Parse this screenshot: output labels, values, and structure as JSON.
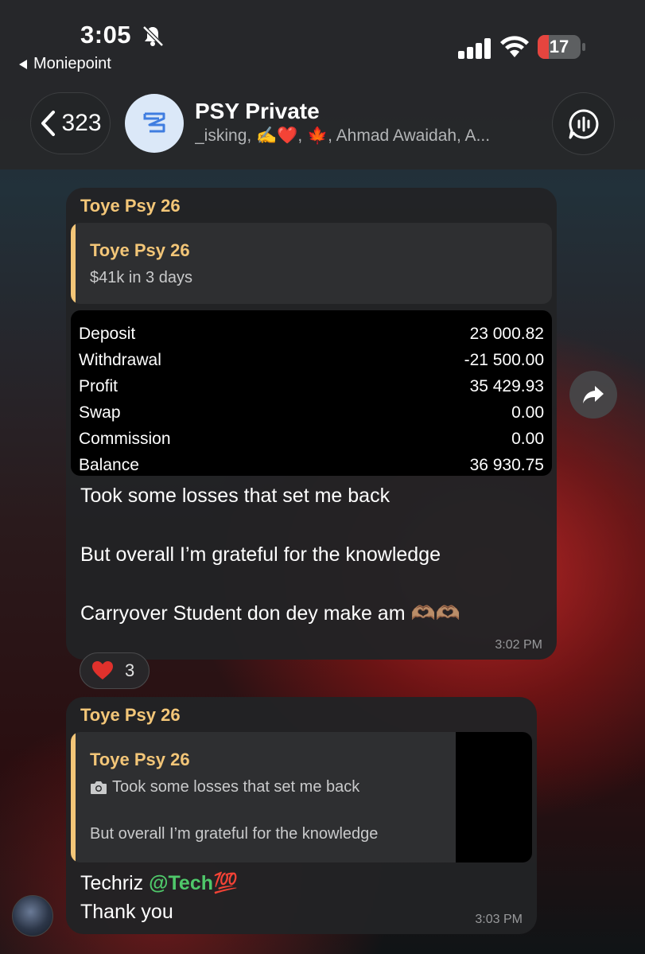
{
  "status_bar": {
    "time": "3:05",
    "back_app": "Moniepoint",
    "battery_level": "17"
  },
  "header": {
    "back_count": "323",
    "title": "PSY Private",
    "subtitle": "_isking, ✍️❤️, 🍁, Ahmad Awaidah, A..."
  },
  "messages": [
    {
      "sender": "Toye Psy 26",
      "reply": {
        "name": "Toye Psy 26",
        "text": "$41k in 3 days"
      },
      "photo_rows": [
        {
          "label": "Deposit",
          "value": "23 000.82"
        },
        {
          "label": "Withdrawal",
          "value": "-21 500.00"
        },
        {
          "label": "Profit",
          "value": "35 429.93"
        },
        {
          "label": "Swap",
          "value": "0.00"
        },
        {
          "label": "Commission",
          "value": "0.00"
        },
        {
          "label": "Balance",
          "value": "36 930.75"
        }
      ],
      "lines": [
        "Took some losses that set me back",
        "But overall I’m grateful for the knowledge",
        "Carryover Student don dey make am 🫶🏽🫶🏽"
      ],
      "time": "3:02 PM",
      "reaction": {
        "emoji": "❤️",
        "count": "3"
      }
    },
    {
      "sender": "Toye Psy 26",
      "reply": {
        "name": "Toye Psy 26",
        "line1": "Took some losses that set me back",
        "line2": "But overall I’m grateful for the knowledge"
      },
      "text_prefix": "Techriz ",
      "mention": "@Tech",
      "text_suffix": "💯",
      "text_line2": "Thank you",
      "time": "3:03 PM"
    }
  ],
  "colors": {
    "sender_name": "#f3c678",
    "mention": "#4fc86a",
    "bubble": "#222325",
    "header": "#26282a"
  },
  "icons": [
    "bell-slash-icon",
    "signal-icon",
    "wifi-icon",
    "chevron-left-icon",
    "group-avatar-icon",
    "voice-chat-icon",
    "forward-icon",
    "camera-icon",
    "heart-icon"
  ]
}
